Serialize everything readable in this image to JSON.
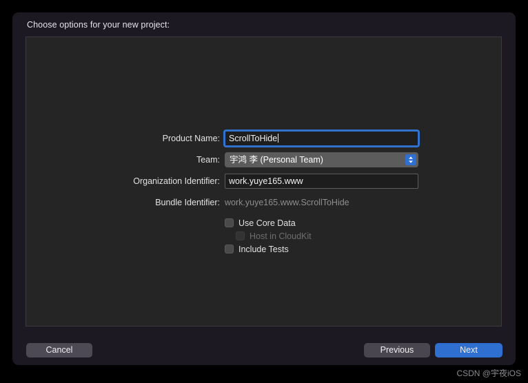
{
  "dialog": {
    "title": "Choose options for your new project:"
  },
  "form": {
    "product_name": {
      "label": "Product Name:",
      "value": "ScrollToHide",
      "placeholder": ""
    },
    "team": {
      "label": "Team:",
      "value": "宇鸿 李 (Personal Team)"
    },
    "organization_identifier": {
      "label": "Organization Identifier:",
      "value": "work.yuye165.www",
      "placeholder": ""
    },
    "bundle_identifier": {
      "label": "Bundle Identifier:",
      "value": "work.yuye165.www.ScrollToHide"
    }
  },
  "checkboxes": [
    {
      "label": "Use Core Data",
      "checked": false,
      "enabled": true
    },
    {
      "label": "Host in CloudKit",
      "checked": false,
      "enabled": false
    },
    {
      "label": "Include Tests",
      "checked": false,
      "enabled": true
    }
  ],
  "footer": {
    "cancel_label": "Cancel",
    "previous_label": "Previous",
    "next_label": "Next"
  },
  "watermark": {
    "text": "CSDN @宇夜iOS"
  },
  "colors": {
    "accent_blue": "#2f6fd0",
    "dialog_bg": "#1d1923",
    "panel_bg": "#252525",
    "button_grey": "#4e4a55",
    "disabled_text": "#6e6e6e"
  }
}
